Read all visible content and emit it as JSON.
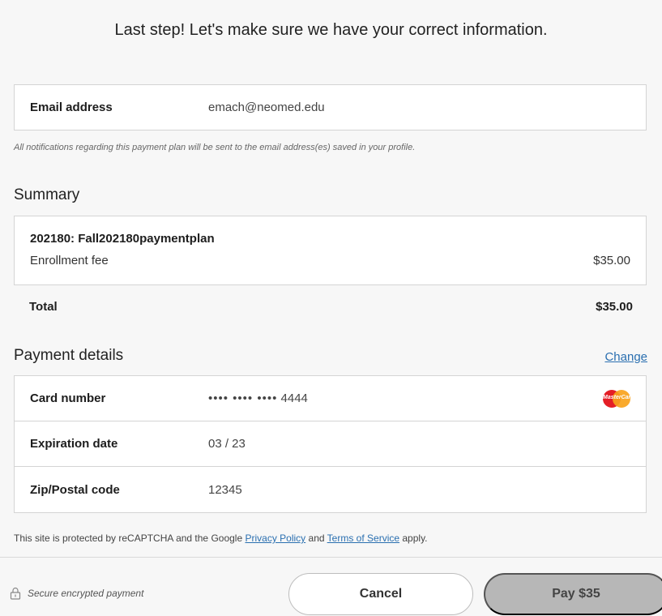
{
  "header": {
    "title": "Last step! Let's make sure we have your correct information."
  },
  "email": {
    "label": "Email address",
    "value": "emach@neomed.edu",
    "notice": "All notifications regarding this payment plan will be sent to the email address(es) saved in your profile."
  },
  "summary": {
    "title": "Summary",
    "plan_name": "202180: Fall202180paymentplan",
    "fee_label": "Enrollment fee",
    "fee_amount": "$35.00",
    "total_label": "Total",
    "total_amount": "$35.00"
  },
  "payment": {
    "title": "Payment details",
    "change_label": "Change",
    "card_label": "Card number",
    "card_dots": "•••• •••• ••••",
    "card_last4": "4444",
    "card_brand": "MasterCard",
    "card_brand_colors": [
      "#e41e26",
      "#f9a31b"
    ],
    "expiration_label": "Expiration date",
    "expiration_value": "03 / 23",
    "zip_label": "Zip/Postal code",
    "zip_value": "12345"
  },
  "recaptcha": {
    "prefix": "This site is protected by reCAPTCHA and the Google",
    "privacy_link": "Privacy Policy",
    "and_text": "and",
    "terms_link": "Terms of Service",
    "suffix": "apply."
  },
  "footer": {
    "secure_text": "Secure encrypted payment",
    "secure_icon": "lock-icon",
    "cancel_label": "Cancel",
    "pay_label": "Pay $35"
  },
  "colors": {
    "link": "#2a6fb0",
    "pay_button_bg": "#b7b7b7"
  }
}
